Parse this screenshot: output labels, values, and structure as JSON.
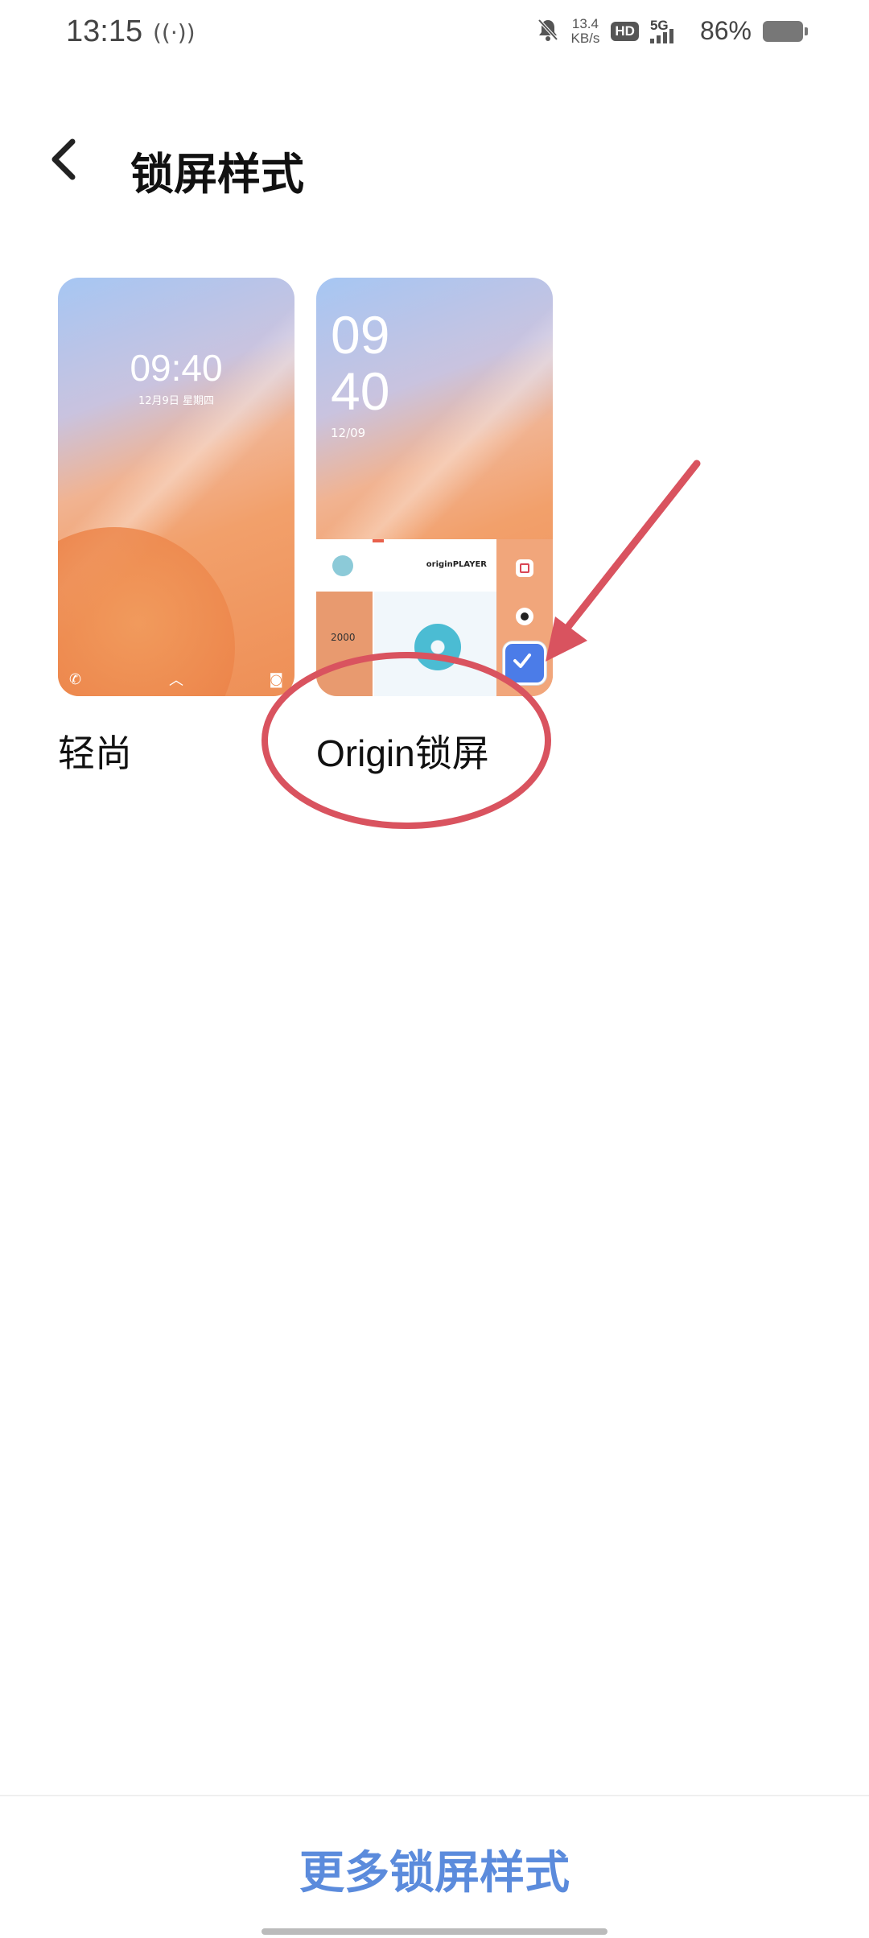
{
  "status_bar": {
    "time": "13:15",
    "hotspot_icon": "hotspot-icon",
    "net_speed_value": "13.4",
    "net_speed_unit": "KB/s",
    "hd_badge": "HD",
    "network": "5G",
    "battery_percent": "86%"
  },
  "header": {
    "back_icon": "chevron-left-icon",
    "title": "锁屏样式"
  },
  "styles": [
    {
      "label": "轻尚",
      "preview_time": "09:40",
      "preview_date": "12月9日 星期四",
      "selected": false
    },
    {
      "label": "Origin锁屏",
      "preview_hour": "09",
      "preview_minute": "40",
      "preview_date": "12/09",
      "preview_brand": "originPLAYER",
      "preview_steps": "2000",
      "selected": true
    }
  ],
  "footer": {
    "more_label": "更多锁屏样式"
  },
  "colors": {
    "accent": "#5b8bdc",
    "check": "#4b7ce8",
    "annotation": "#d9535f"
  }
}
